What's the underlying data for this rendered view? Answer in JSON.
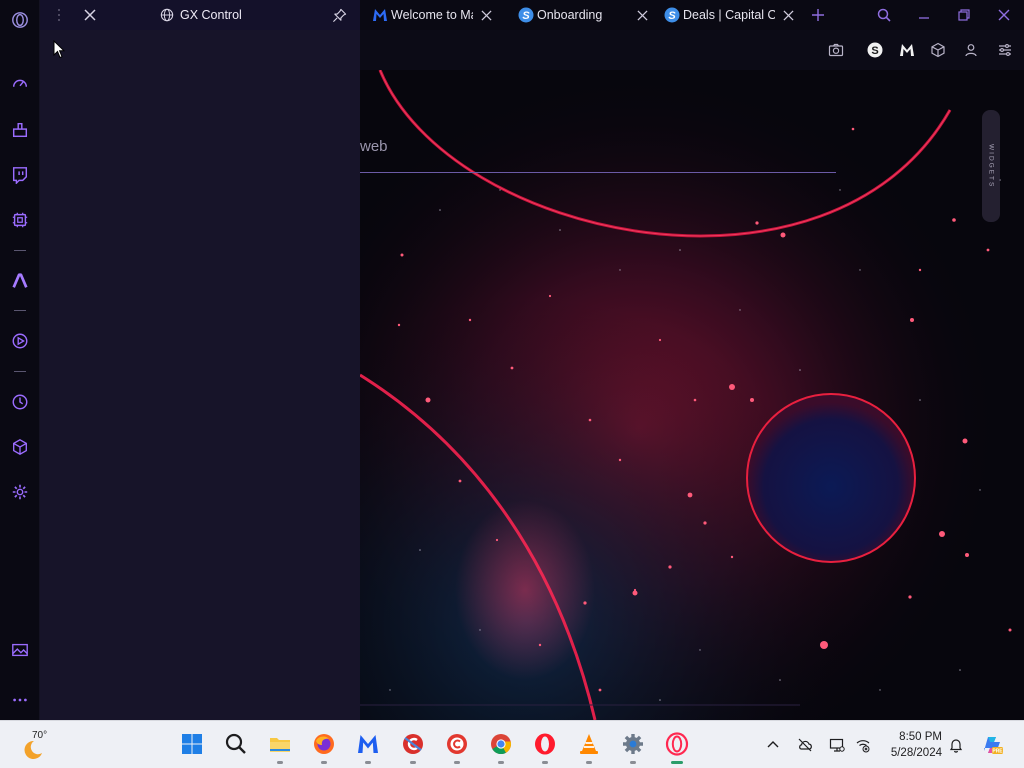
{
  "tabs": [
    {
      "title": "Welcome to Malwarebytes",
      "favicon": "malwarebytes-icon"
    },
    {
      "title": "Onboarding",
      "favicon": "s-logo-icon"
    },
    {
      "title": "Deals | Capital One Shopping",
      "favicon": "s-logo-icon"
    }
  ],
  "panel": {
    "title": "GX Control"
  },
  "page": {
    "search_fragment": "web",
    "widgets_label": "WIDGETS"
  },
  "taskbar": {
    "weather_temp": "70°",
    "time": "8:50 PM",
    "date": "5/28/2024"
  },
  "colors": {
    "accent": "#9b6cff",
    "sidebar_bg": "#0a0913",
    "panel_bg": "#17142a",
    "taskbar_bg": "#eef0f5"
  }
}
